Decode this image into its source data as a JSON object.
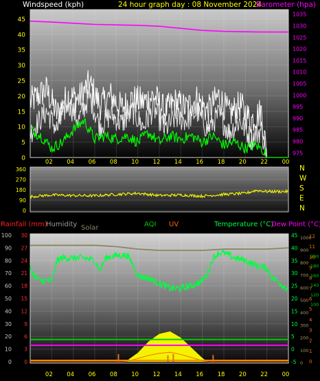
{
  "header": {
    "title": "24 hour graph day : 08 November 2024",
    "title_color": "#ffff00"
  },
  "colors": {
    "background": "#000000",
    "frame": "#cfcfcf",
    "tick_text": "#ffff00",
    "wind": "#ffffff",
    "wind_avg": "#00ff00",
    "baro": "#ff00ff",
    "winddir": "#ffff00",
    "humidity": "#9a9a9a",
    "solar": "#8c8760",
    "temperature": "#00ff40",
    "dewpoint": "#ff00ff",
    "rain": "#ff2020",
    "uv": "#ff6600",
    "aqi": "#00cc00"
  },
  "chart_data": [
    {
      "type": "line",
      "x_ticks": [
        "02",
        "04",
        "06",
        "08",
        "10",
        "12",
        "14",
        "16",
        "18",
        "20",
        "22",
        "00"
      ],
      "left_axis": {
        "label": "Windspeed (kph)",
        "ticks": [
          0,
          5,
          10,
          15,
          20,
          25,
          30,
          35,
          40,
          45
        ],
        "ylim": [
          0,
          48
        ]
      },
      "right_axis": {
        "label": "Barometer (hpa)",
        "ticks": [
          975,
          980,
          985,
          990,
          995,
          1000,
          1005,
          1010,
          1015,
          1020,
          1025,
          1030,
          1035
        ],
        "ylim": [
          973,
          1037
        ]
      },
      "series": [
        {
          "name": "Windspeed (kph)",
          "axis": "left",
          "x": [
            0,
            1.5,
            2.5,
            3.5,
            4.5,
            5.5,
            6.5,
            7.5,
            8.5,
            9.5,
            10.5,
            11.5,
            12.5,
            13.5,
            14.5,
            15.5,
            16.5,
            17.5,
            18.5,
            19.5,
            20.5,
            21.5,
            22,
            23,
            24
          ],
          "values": [
            8,
            15,
            9,
            18,
            12,
            20,
            10,
            14,
            11,
            15,
            10,
            16,
            9,
            13,
            12,
            15,
            9,
            14,
            8,
            12,
            6,
            9,
            0,
            0,
            0
          ],
          "gust_values": [
            18,
            22,
            14,
            20,
            19,
            24,
            17,
            20,
            16,
            19,
            18,
            20,
            15,
            18,
            16,
            19,
            15,
            20,
            14,
            17,
            12,
            15,
            0,
            0,
            0
          ]
        },
        {
          "name": "Wind average",
          "axis": "left",
          "x": [
            0,
            1,
            2,
            3,
            4,
            5,
            6,
            7,
            8,
            9,
            10,
            11,
            12,
            13,
            14,
            15,
            16,
            17,
            18,
            19,
            20,
            21,
            21.8,
            22,
            24
          ],
          "values": [
            9,
            7,
            3,
            5,
            9,
            12,
            6,
            7,
            6,
            7,
            5,
            8,
            5,
            7,
            6,
            7,
            5,
            7,
            4,
            5,
            3,
            4,
            2,
            0,
            0
          ]
        },
        {
          "name": "Barometer (hpa)",
          "axis": "right",
          "x": [
            0,
            2,
            4,
            6,
            8,
            10,
            12,
            14,
            16,
            18,
            20,
            22,
            24
          ],
          "values": [
            1032,
            1031.6,
            1031.1,
            1030.6,
            1030.4,
            1030.2,
            1029.8,
            1028.9,
            1028,
            1027.6,
            1027.4,
            1027.3,
            1027.3
          ]
        }
      ]
    },
    {
      "type": "line",
      "right_labels": [
        "N",
        "W",
        "S",
        "E",
        "N"
      ],
      "y_axis": {
        "ticks": [
          0,
          90,
          180,
          270,
          360
        ],
        "ylim": [
          0,
          360
        ]
      },
      "series": [
        {
          "name": "Wind direction",
          "x": [
            0,
            2,
            4,
            6,
            8,
            10,
            12,
            14,
            16,
            18,
            20,
            21,
            22,
            24
          ],
          "values": [
            120,
            135,
            130,
            128,
            140,
            150,
            130,
            135,
            125,
            140,
            150,
            175,
            165,
            165
          ]
        }
      ]
    },
    {
      "type": "line",
      "legend": {
        "rainfall": "Rainfall (mm)",
        "humidity": "Humidity",
        "solar": "Solar",
        "aqi": "AQI",
        "uv": "UV",
        "temperature": "Temperature (°C)",
        "dewpoint": "Dew Point (°C)"
      },
      "left_axis": {
        "humidity_ticks": [
          0,
          10,
          20,
          30,
          40,
          50,
          60,
          70,
          80,
          90,
          100
        ],
        "rain_ticks": [
          0,
          3,
          6,
          9,
          12,
          15,
          18,
          21,
          24,
          27,
          30
        ]
      },
      "right_axis": {
        "temp_ticks": [
          -5,
          0,
          5,
          10,
          15,
          20,
          25,
          30,
          35,
          40,
          45
        ],
        "ylim": [
          -5,
          45
        ],
        "uv_ticks": [
          "12",
          "11",
          "10",
          "9",
          "8",
          "7",
          "6",
          "5",
          "4",
          "3",
          "2",
          "1",
          "0"
        ],
        "solar_ticks": [
          "1000",
          "900",
          "800",
          "700",
          "600",
          "500",
          "400",
          "300",
          "200",
          "100",
          "0"
        ],
        "aqi_ticks": [
          "200",
          "180",
          "160",
          "140",
          "120",
          "100"
        ]
      },
      "x_ticks": [
        "02",
        "04",
        "06",
        "08",
        "10",
        "12",
        "14",
        "16",
        "18",
        "20",
        "22",
        "00"
      ],
      "series": [
        {
          "name": "Humidity",
          "x": [
            0,
            2,
            4,
            6,
            8,
            10,
            12,
            14,
            16,
            18,
            20,
            22,
            24
          ],
          "values": [
            92,
            92,
            92,
            92,
            91,
            89,
            88,
            88,
            88,
            89,
            89,
            89,
            90
          ]
        },
        {
          "name": "Temperature (°C)",
          "x": [
            0,
            0.5,
            1,
            2,
            2.5,
            3,
            4,
            5,
            6,
            6.5,
            7,
            8,
            9,
            9.5,
            10,
            11,
            12,
            13,
            14,
            15,
            16,
            16.5,
            17,
            17.5,
            18,
            19,
            20,
            21,
            22,
            22.5,
            23,
            23.5,
            24
          ],
          "values": [
            32,
            28,
            27,
            27,
            35,
            36,
            36,
            36,
            35,
            31,
            36,
            37,
            37,
            34,
            29,
            28,
            26,
            24,
            24,
            25,
            27,
            30,
            36,
            38,
            38,
            36,
            35,
            33,
            32,
            28,
            27,
            25,
            24
          ]
        },
        {
          "name": "Dew Point (°C)",
          "x": [
            0,
            24
          ],
          "values": [
            1.5,
            1.5
          ]
        },
        {
          "name": "AQI",
          "x": [
            0,
            24
          ],
          "values": [
            3.8,
            3.8
          ]
        },
        {
          "name": "Solar",
          "x": [
            0,
            8.5,
            9,
            10,
            11,
            12,
            13,
            14,
            15,
            16,
            16.5,
            24
          ],
          "values": [
            0,
            0,
            10,
            70,
            160,
            220,
            240,
            190,
            110,
            30,
            0,
            0
          ]
        },
        {
          "name": "UV",
          "x": [
            0,
            8.5,
            9,
            10,
            11,
            12,
            13,
            14,
            15,
            16,
            16.5,
            24
          ],
          "values": [
            0,
            0,
            0.05,
            0.3,
            0.6,
            0.8,
            0.9,
            0.7,
            0.4,
            0.1,
            0,
            0
          ]
        },
        {
          "name": "Rainfall (mm)",
          "bars_x": [
            8.2,
            12.8,
            13.3,
            17.0
          ],
          "bars_values": [
            1.8,
            1.5,
            1.8,
            1.6
          ]
        }
      ]
    }
  ]
}
